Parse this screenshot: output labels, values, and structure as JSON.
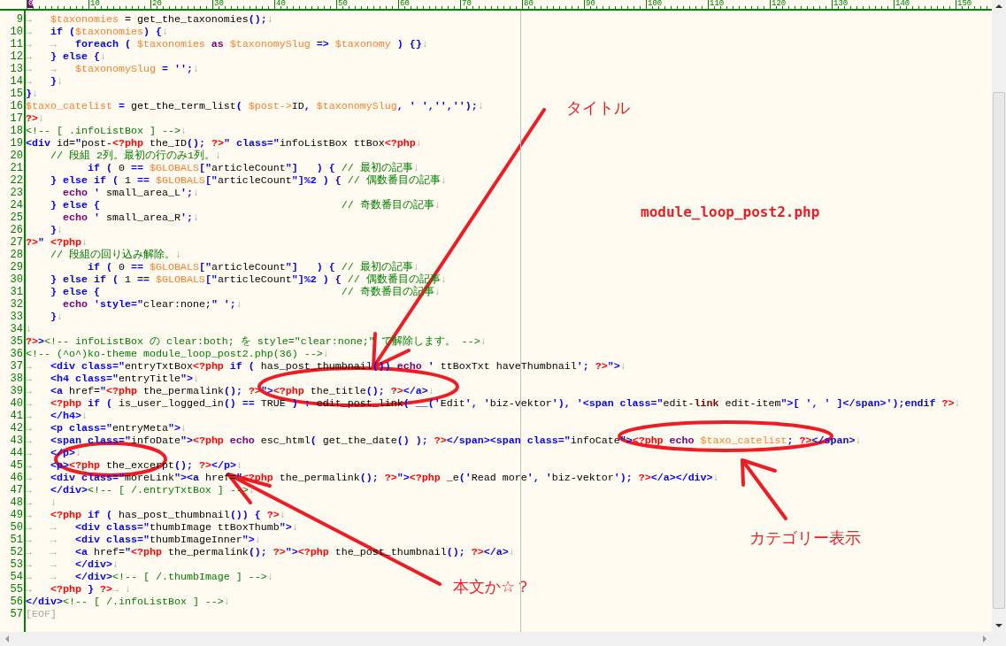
{
  "ruler": [
    "0",
    "10",
    "20",
    "30",
    "40",
    "50",
    "60",
    "70",
    "80",
    "90",
    "100",
    "110",
    "120",
    "130",
    "140",
    "150"
  ],
  "lines": [
    {
      "no": "9",
      "segs": [
        {
          "kind": "mark",
          "text": "→   "
        },
        {
          "kind": "variable",
          "text": "$taxonomies"
        },
        {
          "kind": "plain",
          "text": " = get_the_taxonomies"
        },
        {
          "kind": "keyword",
          "text": "();"
        },
        {
          "kind": "mark",
          "text": "↓"
        }
      ]
    },
    {
      "no": "10",
      "segs": [
        {
          "kind": "mark",
          "text": "→"
        },
        {
          "kind": "keyword",
          "text": "   if ("
        },
        {
          "kind": "variable",
          "text": "$taxonomies"
        },
        {
          "kind": "keyword",
          "text": ") {"
        },
        {
          "kind": "mark",
          "text": "↓"
        }
      ]
    },
    {
      "no": "11",
      "segs": [
        {
          "kind": "mark",
          "text": "→   →"
        },
        {
          "kind": "keyword",
          "text": "   foreach ( "
        },
        {
          "kind": "variable",
          "text": "$taxonomies"
        },
        {
          "kind": "echo",
          "text": " as "
        },
        {
          "kind": "variable",
          "text": "$taxonomySlug"
        },
        {
          "kind": "keyword",
          "text": " => "
        },
        {
          "kind": "variable",
          "text": "$taxonomy"
        },
        {
          "kind": "keyword",
          "text": " ) {}"
        },
        {
          "kind": "mark",
          "text": "↓"
        }
      ]
    },
    {
      "no": "12",
      "segs": [
        {
          "kind": "mark",
          "text": "→"
        },
        {
          "kind": "keyword",
          "text": "   } else {"
        },
        {
          "kind": "mark",
          "text": "↓"
        }
      ]
    },
    {
      "no": "13",
      "segs": [
        {
          "kind": "mark",
          "text": "→   →"
        },
        {
          "kind": "variable",
          "text": "   $taxonomySlug"
        },
        {
          "kind": "keyword",
          "text": " = '';"
        },
        {
          "kind": "mark",
          "text": "↓"
        }
      ]
    },
    {
      "no": "14",
      "segs": [
        {
          "kind": "mark",
          "text": "→"
        },
        {
          "kind": "keyword",
          "text": "   }"
        },
        {
          "kind": "mark",
          "text": "↓"
        }
      ]
    },
    {
      "no": "15",
      "segs": [
        {
          "kind": "keyword",
          "text": "}"
        },
        {
          "kind": "mark",
          "text": "↓"
        }
      ]
    },
    {
      "no": "16",
      "segs": [
        {
          "kind": "variable",
          "text": "$taxo_catelist"
        },
        {
          "kind": "keyword",
          "text": " = "
        },
        {
          "kind": "plain",
          "text": "get_the_term_list"
        },
        {
          "kind": "keyword",
          "text": "( "
        },
        {
          "kind": "variable",
          "text": "$post->"
        },
        {
          "kind": "plain",
          "text": "ID"
        },
        {
          "kind": "keyword",
          "text": ", "
        },
        {
          "kind": "variable",
          "text": "$taxonomySlug"
        },
        {
          "kind": "keyword",
          "text": ", ' ','','');"
        },
        {
          "kind": "mark",
          "text": "↓"
        }
      ]
    },
    {
      "no": "17",
      "segs": [
        {
          "kind": "php",
          "text": "?>"
        },
        {
          "kind": "mark",
          "text": "↓"
        }
      ]
    },
    {
      "no": "18",
      "segs": [
        {
          "kind": "comment",
          "text": "<!-- [ .infoListBox ] -->"
        },
        {
          "kind": "mark",
          "text": "↓"
        }
      ]
    },
    {
      "no": "19",
      "segs": [
        {
          "kind": "keyword",
          "text": "<div"
        },
        {
          "kind": "plain",
          "text": " id="
        },
        {
          "kind": "keyword",
          "text": "\""
        },
        {
          "kind": "plain",
          "text": "post-"
        },
        {
          "kind": "php",
          "text": "<?php"
        },
        {
          "kind": "plain",
          "text": " the_ID"
        },
        {
          "kind": "keyword",
          "text": "();"
        },
        {
          "kind": "php",
          "text": " ?>"
        },
        {
          "kind": "keyword",
          "text": "\" class=\""
        },
        {
          "kind": "plain",
          "text": "infoListBox ttBox"
        },
        {
          "kind": "php",
          "text": "<?php"
        },
        {
          "kind": "mark",
          "text": "↓"
        }
      ]
    },
    {
      "no": "20",
      "segs": [
        {
          "kind": "comment",
          "text": "    // 段組 2列。最初の行のみ1列。"
        },
        {
          "kind": "mark",
          "text": "↓"
        }
      ]
    },
    {
      "no": "21",
      "segs": [
        {
          "kind": "keyword",
          "text": "          if ( "
        },
        {
          "kind": "plain",
          "text": "0"
        },
        {
          "kind": "keyword",
          "text": " == "
        },
        {
          "kind": "variable",
          "text": "$GLOBALS"
        },
        {
          "kind": "keyword",
          "text": "[\""
        },
        {
          "kind": "plain",
          "text": "articleCount"
        },
        {
          "kind": "keyword",
          "text": "\"]   ) { "
        },
        {
          "kind": "comment",
          "text": "// 最初の記事"
        },
        {
          "kind": "mark",
          "text": "↓"
        }
      ]
    },
    {
      "no": "22",
      "segs": [
        {
          "kind": "keyword",
          "text": "    } else if ( "
        },
        {
          "kind": "plain",
          "text": "1"
        },
        {
          "kind": "keyword",
          "text": " == "
        },
        {
          "kind": "variable",
          "text": "$GLOBALS"
        },
        {
          "kind": "keyword",
          "text": "[\""
        },
        {
          "kind": "plain",
          "text": "articleCount"
        },
        {
          "kind": "keyword",
          "text": "\"]%2 ) { "
        },
        {
          "kind": "comment",
          "text": "// 偶数番目の記事"
        },
        {
          "kind": "mark",
          "text": "↓"
        }
      ]
    },
    {
      "no": "23",
      "segs": [
        {
          "kind": "echo",
          "text": "      echo"
        },
        {
          "kind": "keyword",
          "text": " '"
        },
        {
          "kind": "plain",
          "text": " small_area_L"
        },
        {
          "kind": "keyword",
          "text": "';"
        },
        {
          "kind": "mark",
          "text": "↓"
        }
      ]
    },
    {
      "no": "24",
      "segs": [
        {
          "kind": "keyword",
          "text": "    } else {                                       "
        },
        {
          "kind": "comment",
          "text": "// 奇数番目の記事"
        },
        {
          "kind": "mark",
          "text": "↓"
        }
      ]
    },
    {
      "no": "25",
      "segs": [
        {
          "kind": "echo",
          "text": "      echo"
        },
        {
          "kind": "keyword",
          "text": " '"
        },
        {
          "kind": "plain",
          "text": " small_area_R"
        },
        {
          "kind": "keyword",
          "text": "';"
        },
        {
          "kind": "mark",
          "text": "↓"
        }
      ]
    },
    {
      "no": "26",
      "segs": [
        {
          "kind": "keyword",
          "text": "    }"
        },
        {
          "kind": "mark",
          "text": "↓"
        }
      ]
    },
    {
      "no": "27",
      "segs": [
        {
          "kind": "php",
          "text": "?>"
        },
        {
          "kind": "keyword",
          "text": "\" "
        },
        {
          "kind": "php",
          "text": "<?php"
        },
        {
          "kind": "mark",
          "text": "↓"
        }
      ]
    },
    {
      "no": "28",
      "segs": [
        {
          "kind": "comment",
          "text": "    // 段組の回り込み解除。"
        },
        {
          "kind": "mark",
          "text": "↓"
        }
      ]
    },
    {
      "no": "29",
      "segs": [
        {
          "kind": "keyword",
          "text": "          if ( "
        },
        {
          "kind": "plain",
          "text": "0"
        },
        {
          "kind": "keyword",
          "text": " == "
        },
        {
          "kind": "variable",
          "text": "$GLOBALS"
        },
        {
          "kind": "keyword",
          "text": "[\""
        },
        {
          "kind": "plain",
          "text": "articleCount"
        },
        {
          "kind": "keyword",
          "text": "\"]   ) { "
        },
        {
          "kind": "comment",
          "text": "// 最初の記事"
        },
        {
          "kind": "mark",
          "text": "↓"
        }
      ]
    },
    {
      "no": "30",
      "segs": [
        {
          "kind": "keyword",
          "text": "    } else if ( "
        },
        {
          "kind": "plain",
          "text": "1"
        },
        {
          "kind": "keyword",
          "text": " == "
        },
        {
          "kind": "variable",
          "text": "$GLOBALS"
        },
        {
          "kind": "keyword",
          "text": "[\""
        },
        {
          "kind": "plain",
          "text": "articleCount"
        },
        {
          "kind": "keyword",
          "text": "\"]%2 ) { "
        },
        {
          "kind": "comment",
          "text": "// 偶数番目の記事"
        },
        {
          "kind": "mark",
          "text": "↓"
        }
      ]
    },
    {
      "no": "31",
      "segs": [
        {
          "kind": "keyword",
          "text": "    } else {                                       "
        },
        {
          "kind": "comment",
          "text": "// 奇数番目の記事"
        },
        {
          "kind": "mark",
          "text": "↓"
        }
      ]
    },
    {
      "no": "32",
      "segs": [
        {
          "kind": "echo",
          "text": "      echo"
        },
        {
          "kind": "keyword",
          "text": " 'style=\""
        },
        {
          "kind": "plain",
          "text": "clear:none;"
        },
        {
          "kind": "keyword",
          "text": "\" ';"
        },
        {
          "kind": "mark",
          "text": "↓"
        }
      ]
    },
    {
      "no": "33",
      "segs": [
        {
          "kind": "keyword",
          "text": "    }"
        },
        {
          "kind": "mark",
          "text": "↓"
        }
      ]
    },
    {
      "no": "34",
      "segs": [
        {
          "kind": "mark",
          "text": "↓"
        }
      ]
    },
    {
      "no": "35",
      "segs": [
        {
          "kind": "php",
          "text": "?>"
        },
        {
          "kind": "keyword",
          "text": ">"
        },
        {
          "kind": "comment",
          "text": "<!-- infoListBox の clear:both; を style=\"clear:none;\" で解除します。 -->"
        },
        {
          "kind": "mark",
          "text": "↓"
        }
      ]
    },
    {
      "no": "36",
      "segs": [
        {
          "kind": "comment",
          "text": "<!-- (^o^)ko-theme module_loop_post2.php(36) -->"
        },
        {
          "kind": "mark",
          "text": "↓"
        }
      ]
    },
    {
      "no": "37",
      "segs": [
        {
          "kind": "mark",
          "text": "→"
        },
        {
          "kind": "keyword",
          "text": "   <div class=\""
        },
        {
          "kind": "plain",
          "text": "entryTxtBox"
        },
        {
          "kind": "php",
          "text": "<?php"
        },
        {
          "kind": "keyword",
          "text": " if ( "
        },
        {
          "kind": "plain",
          "text": "has_post_thumbnail"
        },
        {
          "kind": "keyword",
          "text": "()) "
        },
        {
          "kind": "echo",
          "text": "echo"
        },
        {
          "kind": "keyword",
          "text": " '"
        },
        {
          "kind": "plain",
          "text": " ttBoxTxt haveThumbnail"
        },
        {
          "kind": "keyword",
          "text": "'; "
        },
        {
          "kind": "php",
          "text": "?>"
        },
        {
          "kind": "keyword",
          "text": "\">"
        },
        {
          "kind": "mark",
          "text": "↓"
        }
      ]
    },
    {
      "no": "38",
      "segs": [
        {
          "kind": "mark",
          "text": "→"
        },
        {
          "kind": "keyword",
          "text": "   <h4 class=\""
        },
        {
          "kind": "plain",
          "text": "entryTitle"
        },
        {
          "kind": "keyword",
          "text": "\">"
        },
        {
          "kind": "mark",
          "text": "↓"
        }
      ]
    },
    {
      "no": "39",
      "segs": [
        {
          "kind": "mark",
          "text": "→"
        },
        {
          "kind": "keyword",
          "text": "   <a "
        },
        {
          "kind": "plain",
          "text": "href="
        },
        {
          "kind": "keyword",
          "text": "\""
        },
        {
          "kind": "php",
          "text": "<?php"
        },
        {
          "kind": "plain",
          "text": " the_permalink"
        },
        {
          "kind": "keyword",
          "text": "(); "
        },
        {
          "kind": "php",
          "text": "?>"
        },
        {
          "kind": "keyword",
          "text": "\">"
        },
        {
          "kind": "php",
          "text": "<?php"
        },
        {
          "kind": "plain",
          "text": " the_title"
        },
        {
          "kind": "keyword",
          "text": "(); "
        },
        {
          "kind": "php",
          "text": "?>"
        },
        {
          "kind": "keyword",
          "text": "</a>"
        },
        {
          "kind": "mark",
          "text": "↓"
        }
      ]
    },
    {
      "no": "40",
      "segs": [
        {
          "kind": "mark",
          "text": "→"
        },
        {
          "kind": "php",
          "text": "   <?php"
        },
        {
          "kind": "keyword",
          "text": " if ( "
        },
        {
          "kind": "plain",
          "text": "is_user_logged_in"
        },
        {
          "kind": "keyword",
          "text": "() == "
        },
        {
          "kind": "plain",
          "text": "TRUE"
        },
        {
          "kind": "keyword",
          "text": " ) : "
        },
        {
          "kind": "plain",
          "text": "edit_post_link"
        },
        {
          "kind": "keyword",
          "text": "( __('"
        },
        {
          "kind": "plain",
          "text": "Edit"
        },
        {
          "kind": "keyword",
          "text": "', '"
        },
        {
          "kind": "plain",
          "text": "biz-vektor"
        },
        {
          "kind": "keyword",
          "text": "'), '<span class=\""
        },
        {
          "kind": "plain",
          "text": "edit-"
        },
        {
          "kind": "attr",
          "text": "link"
        },
        {
          "kind": "plain",
          "text": " edit-item"
        },
        {
          "kind": "keyword",
          "text": "\">[ ', ' ]</span>');endif "
        },
        {
          "kind": "php",
          "text": "?>"
        },
        {
          "kind": "mark",
          "text": "↓"
        }
      ]
    },
    {
      "no": "41",
      "segs": [
        {
          "kind": "mark",
          "text": "→"
        },
        {
          "kind": "keyword",
          "text": "   </h4>"
        },
        {
          "kind": "mark",
          "text": "↓"
        }
      ]
    },
    {
      "no": "42",
      "segs": [
        {
          "kind": "mark",
          "text": "→"
        },
        {
          "kind": "keyword",
          "text": "   <p class=\""
        },
        {
          "kind": "plain",
          "text": "entryMeta"
        },
        {
          "kind": "keyword",
          "text": "\">"
        },
        {
          "kind": "mark",
          "text": "↓"
        }
      ]
    },
    {
      "no": "43",
      "segs": [
        {
          "kind": "mark",
          "text": "→"
        },
        {
          "kind": "keyword",
          "text": "   <span class=\""
        },
        {
          "kind": "plain",
          "text": "infoDate"
        },
        {
          "kind": "keyword",
          "text": "\">"
        },
        {
          "kind": "php",
          "text": "<?php"
        },
        {
          "kind": "echo",
          "text": " echo"
        },
        {
          "kind": "plain",
          "text": " esc_html"
        },
        {
          "kind": "keyword",
          "text": "( "
        },
        {
          "kind": "plain",
          "text": "get_the_date"
        },
        {
          "kind": "keyword",
          "text": "() ); "
        },
        {
          "kind": "php",
          "text": "?>"
        },
        {
          "kind": "keyword",
          "text": "</span><span class=\""
        },
        {
          "kind": "plain",
          "text": "infoCate"
        },
        {
          "kind": "keyword",
          "text": "\">"
        },
        {
          "kind": "php",
          "text": "<?php"
        },
        {
          "kind": "echo",
          "text": " echo "
        },
        {
          "kind": "variable",
          "text": "$taxo_catelist"
        },
        {
          "kind": "keyword",
          "text": "; "
        },
        {
          "kind": "php",
          "text": "?>"
        },
        {
          "kind": "keyword",
          "text": "</span>"
        },
        {
          "kind": "mark",
          "text": "↓"
        }
      ]
    },
    {
      "no": "44",
      "segs": [
        {
          "kind": "mark",
          "text": "→"
        },
        {
          "kind": "keyword",
          "text": "   </p>"
        },
        {
          "kind": "mark",
          "text": "↓"
        }
      ]
    },
    {
      "no": "45",
      "segs": [
        {
          "kind": "mark",
          "text": "→"
        },
        {
          "kind": "keyword",
          "text": "   <p>"
        },
        {
          "kind": "php",
          "text": "<?php"
        },
        {
          "kind": "plain",
          "text": " the_excerpt"
        },
        {
          "kind": "keyword",
          "text": "(); "
        },
        {
          "kind": "php",
          "text": "?>"
        },
        {
          "kind": "keyword",
          "text": "</p>"
        },
        {
          "kind": "mark",
          "text": "↓"
        }
      ]
    },
    {
      "no": "46",
      "segs": [
        {
          "kind": "mark",
          "text": "→"
        },
        {
          "kind": "keyword",
          "text": "   <div class=\""
        },
        {
          "kind": "plain",
          "text": "moreLink"
        },
        {
          "kind": "keyword",
          "text": "\"><a "
        },
        {
          "kind": "plain",
          "text": "href="
        },
        {
          "kind": "keyword",
          "text": "\""
        },
        {
          "kind": "php",
          "text": "<?php"
        },
        {
          "kind": "plain",
          "text": " the_permalink"
        },
        {
          "kind": "keyword",
          "text": "(); "
        },
        {
          "kind": "php",
          "text": "?>"
        },
        {
          "kind": "keyword",
          "text": "\">"
        },
        {
          "kind": "php",
          "text": "<?php"
        },
        {
          "kind": "plain",
          "text": " _e"
        },
        {
          "kind": "keyword",
          "text": "('"
        },
        {
          "kind": "plain",
          "text": "Read more"
        },
        {
          "kind": "keyword",
          "text": "', '"
        },
        {
          "kind": "plain",
          "text": "biz-vektor"
        },
        {
          "kind": "keyword",
          "text": "'); "
        },
        {
          "kind": "php",
          "text": "?>"
        },
        {
          "kind": "keyword",
          "text": "</a></div>"
        },
        {
          "kind": "mark",
          "text": "↓"
        }
      ]
    },
    {
      "no": "47",
      "segs": [
        {
          "kind": "mark",
          "text": "→"
        },
        {
          "kind": "keyword",
          "text": "   </div>"
        },
        {
          "kind": "comment",
          "text": "<!-- [ /.entryTxtBox ] -->"
        },
        {
          "kind": "mark",
          "text": "↓"
        }
      ]
    },
    {
      "no": "48",
      "segs": [
        {
          "kind": "mark",
          "text": "→   ↓"
        }
      ]
    },
    {
      "no": "49",
      "segs": [
        {
          "kind": "mark",
          "text": "→"
        },
        {
          "kind": "php",
          "text": "   <?php"
        },
        {
          "kind": "keyword",
          "text": " if ( "
        },
        {
          "kind": "plain",
          "text": "has_post_thumbnail"
        },
        {
          "kind": "keyword",
          "text": "()) { "
        },
        {
          "kind": "php",
          "text": "?>"
        },
        {
          "kind": "mark",
          "text": "↓"
        }
      ]
    },
    {
      "no": "50",
      "segs": [
        {
          "kind": "mark",
          "text": "→   →"
        },
        {
          "kind": "keyword",
          "text": "   <div class=\""
        },
        {
          "kind": "plain",
          "text": "thumbImage ttBoxThumb"
        },
        {
          "kind": "keyword",
          "text": "\">"
        },
        {
          "kind": "mark",
          "text": "↓"
        }
      ]
    },
    {
      "no": "51",
      "segs": [
        {
          "kind": "mark",
          "text": "→   →"
        },
        {
          "kind": "keyword",
          "text": "   <div class=\""
        },
        {
          "kind": "plain",
          "text": "thumbImageInner"
        },
        {
          "kind": "keyword",
          "text": "\">"
        },
        {
          "kind": "mark",
          "text": "↓"
        }
      ]
    },
    {
      "no": "52",
      "segs": [
        {
          "kind": "mark",
          "text": "→   →"
        },
        {
          "kind": "keyword",
          "text": "   <a "
        },
        {
          "kind": "plain",
          "text": "href="
        },
        {
          "kind": "keyword",
          "text": "\""
        },
        {
          "kind": "php",
          "text": "<?php"
        },
        {
          "kind": "plain",
          "text": " the_permalink"
        },
        {
          "kind": "keyword",
          "text": "(); "
        },
        {
          "kind": "php",
          "text": "?>"
        },
        {
          "kind": "keyword",
          "text": "\">"
        },
        {
          "kind": "php",
          "text": "<?php"
        },
        {
          "kind": "plain",
          "text": " the_post_thumbnail"
        },
        {
          "kind": "keyword",
          "text": "(); "
        },
        {
          "kind": "php",
          "text": "?>"
        },
        {
          "kind": "keyword",
          "text": "</a>"
        },
        {
          "kind": "mark",
          "text": "↓"
        }
      ]
    },
    {
      "no": "53",
      "segs": [
        {
          "kind": "mark",
          "text": "→   →"
        },
        {
          "kind": "keyword",
          "text": "   </div>"
        },
        {
          "kind": "mark",
          "text": "↓"
        }
      ]
    },
    {
      "no": "54",
      "segs": [
        {
          "kind": "mark",
          "text": "→   →"
        },
        {
          "kind": "keyword",
          "text": "   </div>"
        },
        {
          "kind": "comment",
          "text": "<!-- [ /.thumbImage ] -->"
        },
        {
          "kind": "mark",
          "text": "↓"
        }
      ]
    },
    {
      "no": "55",
      "segs": [
        {
          "kind": "mark",
          "text": "→"
        },
        {
          "kind": "php",
          "text": "   <?php"
        },
        {
          "kind": "keyword",
          "text": " } "
        },
        {
          "kind": "php",
          "text": "?>"
        },
        {
          "kind": "mark",
          "text": "→ ↓"
        }
      ]
    },
    {
      "no": "56",
      "segs": [
        {
          "kind": "keyword",
          "text": "</div>"
        },
        {
          "kind": "comment",
          "text": "<!-- [ /.infoListBox ] -->"
        },
        {
          "kind": "mark",
          "text": "↓"
        }
      ]
    },
    {
      "no": "57",
      "segs": [
        {
          "kind": "mark",
          "text": "[EOF]"
        }
      ]
    }
  ],
  "annotations": [
    {
      "kind": "label",
      "text": "タイトル"
    },
    {
      "kind": "title",
      "text": "module_loop_post2.php"
    },
    {
      "kind": "label",
      "text": "カテゴリー表示"
    },
    {
      "kind": "label",
      "text": "本文か☆？"
    }
  ]
}
